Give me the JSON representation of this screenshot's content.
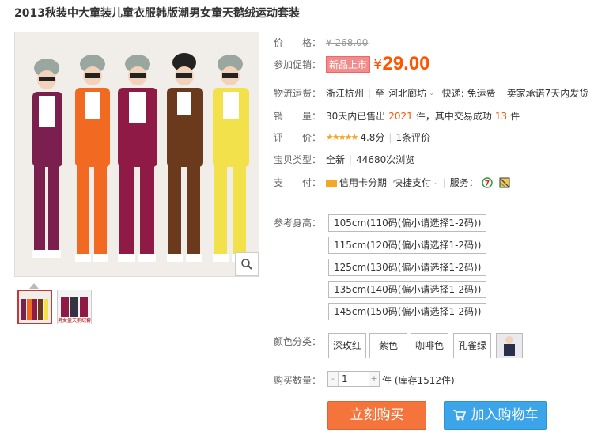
{
  "product": {
    "title": "2013秋装中大童装儿童衣服韩版潮男女童天鹅绒运动套装"
  },
  "gallery": {
    "thumb_caption": "男女童天鹅绒套装"
  },
  "price": {
    "label": "价　　格：",
    "original": "¥ 268.00",
    "promo_label": "参加促销：",
    "promo_tag": "新品上市",
    "currency": "¥",
    "promo_price": "29.00"
  },
  "shipping": {
    "label": "物流运费：",
    "from": "浙江杭州",
    "to_prefix": "至",
    "to": "河北廊坊",
    "express": "快递: 免运费",
    "promise": "卖家承诺7天内发货"
  },
  "sales": {
    "label": "销　　量：",
    "prefix": "30天内已售出",
    "count": "2021",
    "middle": "件，其中交易成功",
    "success": "13",
    "suffix": "件"
  },
  "rating": {
    "label": "评　　价：",
    "stars": "★★★★★",
    "score": "4.8分",
    "reviews": "1条评价"
  },
  "item_type": {
    "label": "宝贝类型：",
    "value": "全新",
    "views": "44680次浏览"
  },
  "payment": {
    "label": "支　　付：",
    "credit": "信用卡分期",
    "quick": "快捷支付",
    "service_label": "服务："
  },
  "size": {
    "label": "参考身高：",
    "options": [
      "105cm(110码(偏小请选择1-2码))",
      "115cm(120码(偏小请选择1-2码))",
      "125cm(130码(偏小请选择1-2码))",
      "135cm(140码(偏小请选择1-2码))",
      "145cm(150码(偏小请选择1-2码))"
    ]
  },
  "color": {
    "label": "颜色分类：",
    "options": [
      "深玫红",
      "紫色",
      "咖啡色",
      "孔雀绿"
    ]
  },
  "quantity": {
    "label": "购买数量：",
    "minus": "-",
    "value": "1",
    "plus": "+",
    "stock": "件 (库存1512件)"
  },
  "actions": {
    "buy_now": "立刻购买",
    "add_cart": "加入购物车"
  },
  "colors": {
    "accent": "#ff5500",
    "buy_now_bg": "#f4743b",
    "add_cart_bg": "#3ca4e8"
  },
  "icons": [
    "search-zoom-icon",
    "credit-card-icon",
    "tmall-service-icon",
    "guarantee-icon",
    "cart-icon"
  ]
}
